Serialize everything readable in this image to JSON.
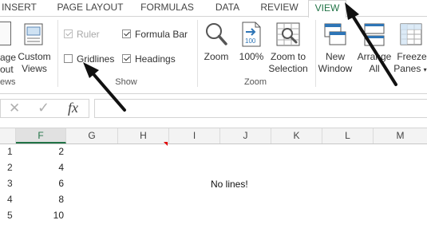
{
  "tabs": [
    "INSERT",
    "PAGE LAYOUT",
    "FORMULAS",
    "DATA",
    "REVIEW",
    "VIEW"
  ],
  "ribbon": {
    "views_group": {
      "page_break_label_line1": "age",
      "page_break_label_line2": "out",
      "custom_views_line1": "Custom",
      "custom_views_line2": "Views",
      "group_label": "ews"
    },
    "show_group": {
      "ruler": "Ruler",
      "formula_bar": "Formula Bar",
      "gridlines": "Gridlines",
      "headings": "Headings",
      "ruler_checked": true,
      "formula_bar_checked": true,
      "gridlines_checked": false,
      "headings_checked": true,
      "group_label": "Show"
    },
    "zoom_group": {
      "zoom": "Zoom",
      "hundred": "100%",
      "zoom_sel_line1": "Zoom to",
      "zoom_sel_line2": "Selection",
      "group_label": "Zoom"
    },
    "window_group": {
      "new_window_line1": "New",
      "new_window_line2": "Window",
      "arrange_line1": "Arrange",
      "arrange_line2": "All",
      "freeze_line1": "Freeze",
      "freeze_line2": "Panes"
    }
  },
  "formula_bar": {
    "cancel_glyph": "✕",
    "enter_glyph": "✓",
    "fx_glyph": "fx"
  },
  "columns": [
    "F",
    "G",
    "H",
    "I",
    "J",
    "K",
    "L",
    "M"
  ],
  "selected_column": "F",
  "rows": [
    {
      "num": "1",
      "F": "2"
    },
    {
      "num": "2",
      "F": "4"
    },
    {
      "num": "3",
      "F": "6"
    },
    {
      "num": "4",
      "F": "8"
    },
    {
      "num": "5",
      "F": "10"
    }
  ],
  "annotation": "No lines!",
  "colors": {
    "accent": "#217346",
    "arrow": "#111111"
  }
}
